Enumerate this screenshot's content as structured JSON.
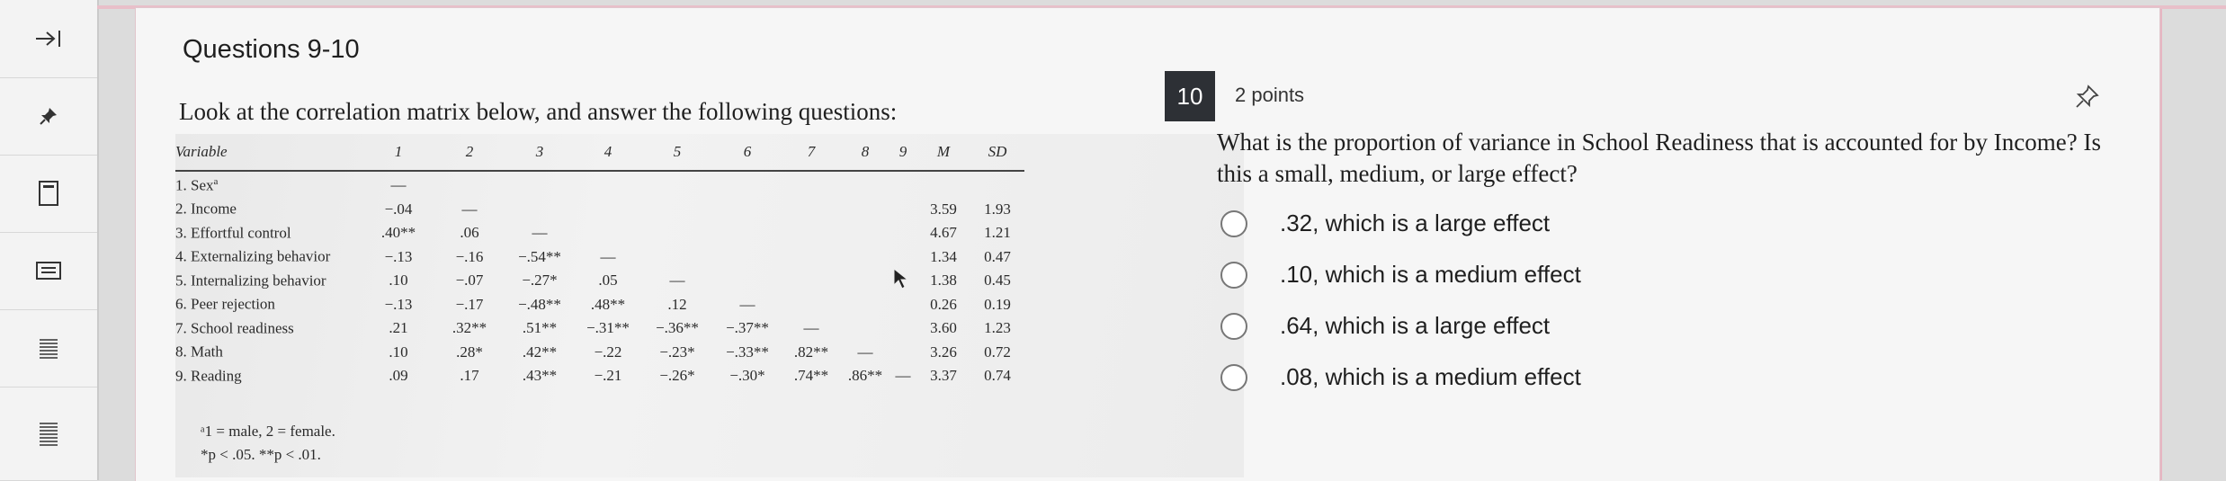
{
  "toolbar": {
    "items": [
      {
        "icon": "collapse-arrow-icon"
      },
      {
        "icon": "pin-icon"
      },
      {
        "icon": "calculator-icon"
      },
      {
        "icon": "keyboard-icon"
      },
      {
        "icon": "lines-icon"
      },
      {
        "icon": "notes-icon"
      }
    ]
  },
  "header": {
    "title": "Questions 9-10"
  },
  "instructions": "Look at the correlation matrix below, and answer the following questions:",
  "matrix": {
    "columns": [
      "Variable",
      "1",
      "2",
      "3",
      "4",
      "5",
      "6",
      "7",
      "8",
      "9",
      "M",
      "SD"
    ],
    "rows": [
      {
        "label": "1. Sex",
        "sup": "a",
        "cells": [
          "—",
          "",
          "",
          "",
          "",
          "",
          "",
          "",
          "",
          "",
          ""
        ]
      },
      {
        "label": "2. Income",
        "sup": "",
        "cells": [
          "−.04",
          "—",
          "",
          "",
          "",
          "",
          "",
          "",
          "",
          "3.59",
          "1.93"
        ]
      },
      {
        "label": "3. Effortful control",
        "sup": "",
        "cells": [
          ".40**",
          ".06",
          "—",
          "",
          "",
          "",
          "",
          "",
          "",
          "4.67",
          "1.21"
        ]
      },
      {
        "label": "4. Externalizing behavior",
        "sup": "",
        "cells": [
          "−.13",
          "−.16",
          "−.54**",
          "—",
          "",
          "",
          "",
          "",
          "",
          "1.34",
          "0.47"
        ]
      },
      {
        "label": "5. Internalizing behavior",
        "sup": "",
        "cells": [
          ".10",
          "−.07",
          "−.27*",
          ".05",
          "—",
          "",
          "",
          "",
          "",
          "1.38",
          "0.45"
        ]
      },
      {
        "label": "6. Peer rejection",
        "sup": "",
        "cells": [
          "−.13",
          "−.17",
          "−.48**",
          ".48**",
          ".12",
          "—",
          "",
          "",
          "",
          "0.26",
          "0.19"
        ]
      },
      {
        "label": "7. School readiness",
        "sup": "",
        "cells": [
          ".21",
          ".32**",
          ".51**",
          "−.31**",
          "−.36**",
          "−.37**",
          "—",
          "",
          "",
          "3.60",
          "1.23"
        ]
      },
      {
        "label": "8. Math",
        "sup": "",
        "cells": [
          ".10",
          ".28*",
          ".42**",
          "−.22",
          "−.23*",
          "−.33**",
          ".82**",
          "—",
          "",
          "3.26",
          "0.72"
        ]
      },
      {
        "label": "9. Reading",
        "sup": "",
        "cells": [
          ".09",
          ".17",
          ".43**",
          "−.21",
          "−.26*",
          "−.30*",
          ".74**",
          ".86**",
          "—",
          "3.37",
          "0.74"
        ]
      }
    ],
    "note1": "ᵃ1 = male, 2 = female.",
    "note2": "*p < .05. **p < .01."
  },
  "question": {
    "number": "10",
    "points": "2 points",
    "text": "What is the proportion of variance in School Readiness that is accounted for by Income? Is this a small, medium, or large effect?",
    "options": [
      ".32, which is a large effect",
      ".10, which is a medium effect",
      ".64, which is a large effect",
      ".08, which is a medium effect"
    ]
  }
}
